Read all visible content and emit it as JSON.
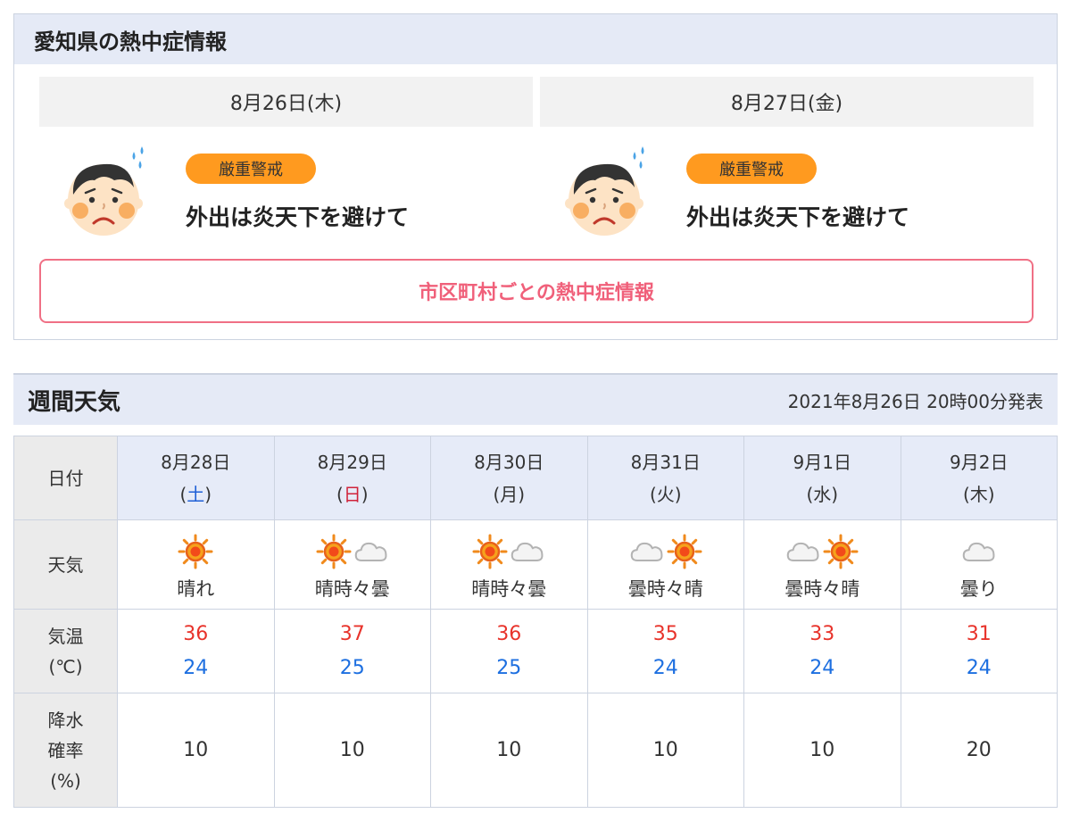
{
  "heat": {
    "title": "愛知県の熱中症情報",
    "days": [
      {
        "date": "8月26日(木)",
        "level": "厳重警戒",
        "advice": "外出は炎天下を避けて"
      },
      {
        "date": "8月27日(金)",
        "level": "厳重警戒",
        "advice": "外出は炎天下を避けて"
      }
    ],
    "city_link": "市区町村ごとの熱中症情報",
    "colors": {
      "badge": "#ff9a1f",
      "link": "#f0607a"
    }
  },
  "week": {
    "title": "週間天気",
    "published": "2021年8月26日 20時00分発表",
    "labels": {
      "date": "日付",
      "weather": "天気",
      "temp_1": "気温",
      "temp_2": "(℃)",
      "rain_1": "降水",
      "rain_2": "確率",
      "rain_3": "(%)"
    },
    "days": [
      {
        "date": "8月28日",
        "dow": "土",
        "weather": "晴れ",
        "icons": [
          "sun-icon"
        ],
        "high": "36",
        "low": "24",
        "rain": "10"
      },
      {
        "date": "8月29日",
        "dow": "日",
        "weather": "晴時々曇",
        "icons": [
          "sun-icon",
          "cloud-icon"
        ],
        "high": "37",
        "low": "25",
        "rain": "10"
      },
      {
        "date": "8月30日",
        "dow": "月",
        "weather": "晴時々曇",
        "icons": [
          "sun-icon",
          "cloud-icon"
        ],
        "high": "36",
        "low": "25",
        "rain": "10"
      },
      {
        "date": "8月31日",
        "dow": "火",
        "weather": "曇時々晴",
        "icons": [
          "cloud-icon",
          "sun-icon"
        ],
        "high": "35",
        "low": "24",
        "rain": "10"
      },
      {
        "date": "9月1日",
        "dow": "水",
        "weather": "曇時々晴",
        "icons": [
          "cloud-icon",
          "sun-icon"
        ],
        "high": "33",
        "low": "24",
        "rain": "10"
      },
      {
        "date": "9月2日",
        "dow": "木",
        "weather": "曇り",
        "icons": [
          "cloud-icon"
        ],
        "high": "31",
        "low": "24",
        "rain": "20"
      }
    ],
    "colors": {
      "high": "#e8332b",
      "low": "#1d6fe0",
      "saturday": "#1e5fd6",
      "sunday": "#d0223a"
    }
  }
}
